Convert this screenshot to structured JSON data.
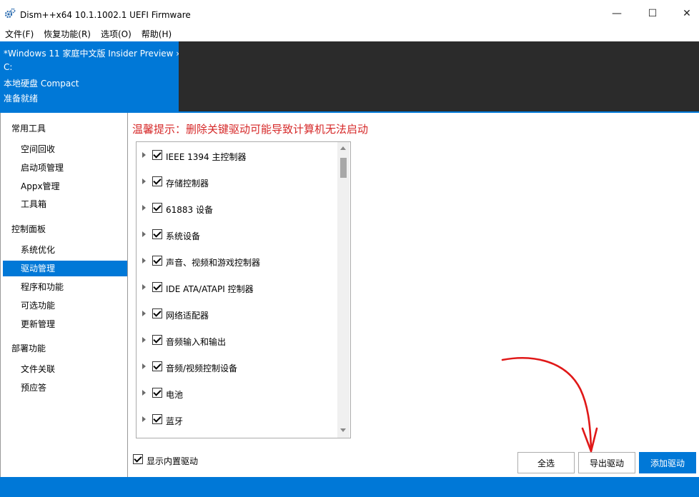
{
  "window": {
    "title": "Dism++x64 10.1.1002.1 UEFI Firmware",
    "minimize_glyph": "—",
    "maximize_glyph": "☐",
    "close_glyph": "✕"
  },
  "menu": [
    "文件(F)",
    "恢复功能(R)",
    "选项(O)",
    "帮助(H)"
  ],
  "image_info": {
    "name": "*Windows 11 家庭中文版 Insider Preview ›",
    "drive": "C:",
    "type": "本地硬盘 Compact",
    "status": "准备就绪"
  },
  "sidebar": {
    "groups": [
      {
        "label": "常用工具",
        "items": [
          "空间回收",
          "启动项管理",
          "Appx管理",
          "工具箱"
        ]
      },
      {
        "label": "控制面板",
        "items": [
          "系统优化",
          "驱动管理",
          "程序和功能",
          "可选功能",
          "更新管理"
        ]
      },
      {
        "label": "部署功能",
        "items": [
          "文件关联",
          "预应答"
        ]
      }
    ],
    "selected": "驱动管理"
  },
  "main": {
    "warning": "温馨提示：删除关键驱动可能导致计算机无法启动",
    "driver_categories": [
      "IEEE 1394 主控制器",
      "存储控制器",
      "61883 设备",
      "系统设备",
      "声音、视频和游戏控制器",
      "IDE ATA/ATAPI 控制器",
      "网络适配器",
      "音频输入和输出",
      "音频/视频控制设备",
      "电池",
      "蓝牙"
    ],
    "show_builtin_label": "显示内置驱动",
    "buttons": {
      "select_all": "全选",
      "export": "导出驱动",
      "add": "添加驱动"
    }
  },
  "colors": {
    "accent": "#0078d7",
    "warning_text": "#d62828",
    "annotation_red": "#e01818"
  }
}
